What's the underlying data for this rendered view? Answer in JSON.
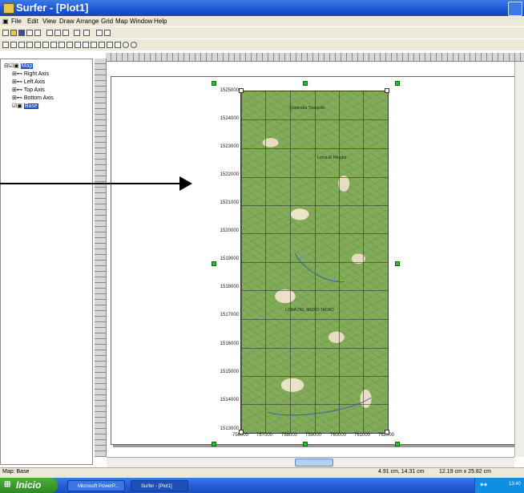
{
  "window": {
    "title": "Surfer - [Plot1]"
  },
  "menu": [
    "File",
    "Edit",
    "View",
    "Draw",
    "Arrange",
    "Grid",
    "Map",
    "Window",
    "Help"
  ],
  "tree": {
    "root": "Map",
    "items": [
      "Right Axis",
      "Left Axis",
      "Top Axis",
      "Bottom Axis",
      "Base"
    ]
  },
  "map": {
    "y_ticks": [
      "1525000",
      "1524000",
      "1523000",
      "1522000",
      "1521000",
      "1520000",
      "1519000",
      "1518000",
      "1517000",
      "1516000",
      "1515000",
      "1514000",
      "1513000"
    ],
    "x_ticks": [
      "756000",
      "757000",
      "758000",
      "759000",
      "760000",
      "761000",
      "762000"
    ],
    "labels": [
      "Quebrada Tinaquillo",
      "Loma El Mirador",
      "LOMA DEL MEDIO TACAO"
    ]
  },
  "status": {
    "left": "Map: Base",
    "coords": "4.91 cm, 14.31 cm",
    "size": "12.19 cm x 25.82 cm"
  },
  "taskbar": {
    "start": "Inicio",
    "tasks": [
      "Microsoft PowerP...",
      "Surfer - [Plot1]"
    ],
    "clock": "13:40"
  }
}
